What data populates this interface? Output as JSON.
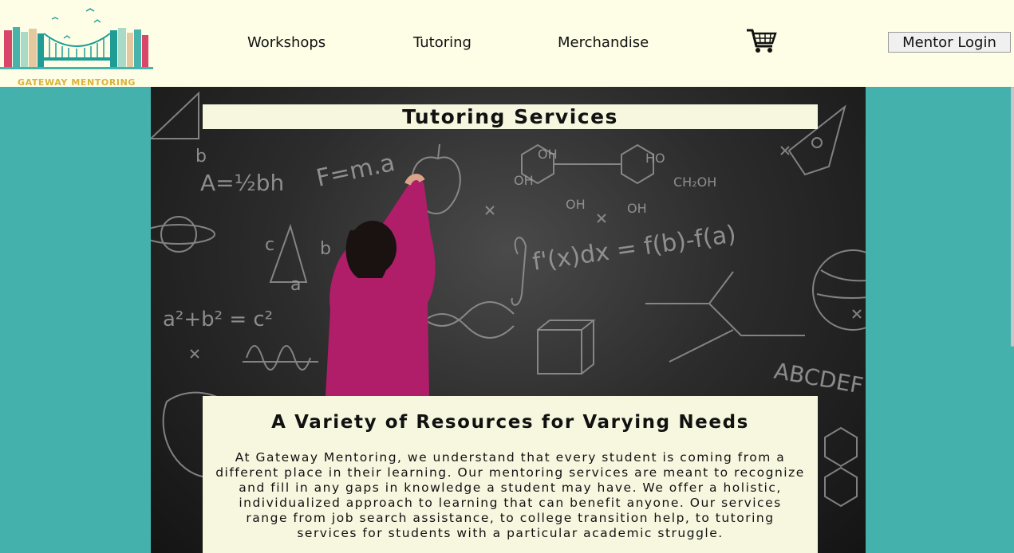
{
  "logo": {
    "text": "GATEWAY MENTORING",
    "colors": [
      "#d8476a",
      "#47b3ad",
      "#e3c8a0",
      "#a9d9c7",
      "#1f9c96"
    ]
  },
  "nav": {
    "workshops": "Workshops",
    "tutoring": "Tutoring",
    "merchandise": "Merchandise",
    "cart_icon": "shopping-cart-icon",
    "login": "Mentor Login"
  },
  "hero": {
    "title": "Tutoring Services",
    "heading": "A Variety of Resources for Varying Needs",
    "body": "At Gateway Mentoring, we understand that every student is coming from a different place in their learning. Our mentoring services are meant to recognize and fill in any gaps in knowledge a student may have. We offer a holistic, individualized approach to learning that can benefit anyone. Our services range from job search assistance, to college transition help, to tutoring services for students with a particular academic struggle."
  },
  "chalkboard": {
    "formulas": [
      "A=½bh",
      "F=m.a",
      "a²+b²=c²",
      "∫f'(x)dx = f(b)-f(a)",
      "ABCDEF",
      "OH",
      "HO",
      "CH₂OH",
      "b",
      "c",
      "a"
    ]
  },
  "colors": {
    "page_bg": "#45b1ad",
    "header_bg": "#fefee6",
    "panel_bg": "#f7f7e0"
  }
}
